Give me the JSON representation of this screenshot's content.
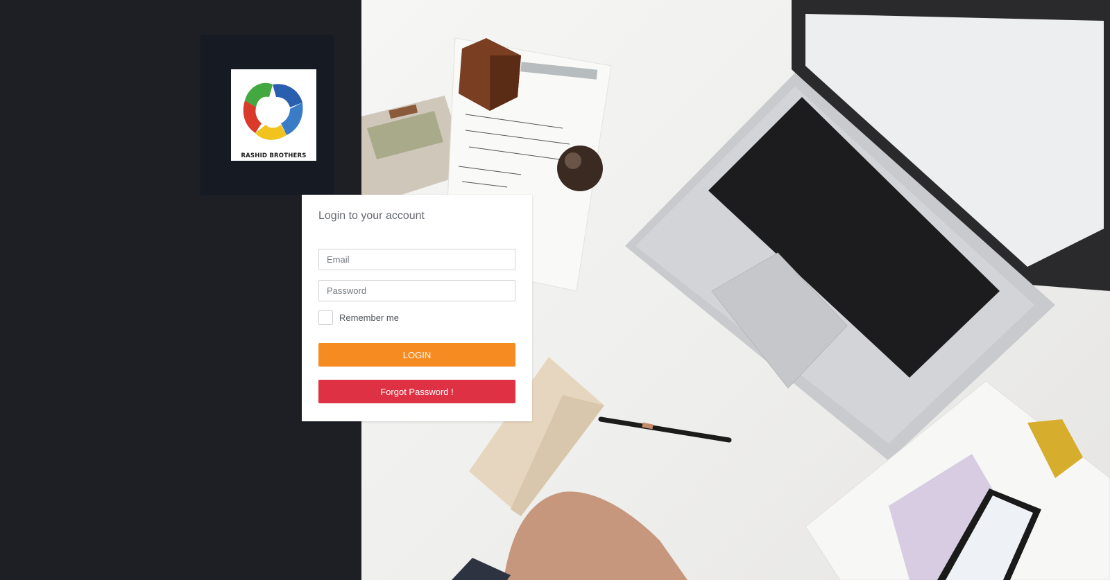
{
  "brand": {
    "logo_caption": "RASHID BROTHERS"
  },
  "login": {
    "title": "Login to your account",
    "email_placeholder": "Email",
    "password_placeholder": "Password",
    "remember_label": "Remember me",
    "login_button": "LOGIN",
    "forgot_button": "Forgot Password !"
  },
  "colors": {
    "login_button": "#f68b22",
    "forgot_button": "#de3244",
    "sidebar_bg": "#1d1f24"
  }
}
